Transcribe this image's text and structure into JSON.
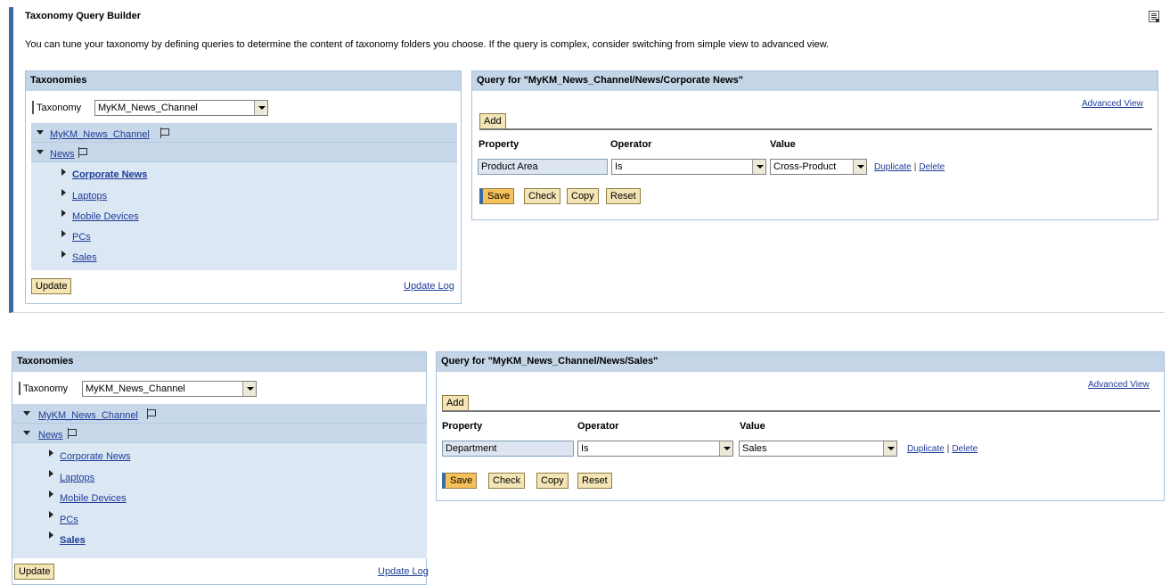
{
  "page": {
    "title": "Taxonomy Query Builder",
    "intro": "You can tune your taxonomy by defining queries to determine the content of taxonomy folders you choose. If the query is complex, consider switching from simple view to advanced view."
  },
  "section1": {
    "taxonomies": {
      "header": "Taxonomies",
      "taxonomy_label": "Taxonomy",
      "taxonomy_value": "MyKM_News_Channel",
      "tree": {
        "root": "MyKM_News_Channel",
        "child": "News",
        "items": [
          "Corporate News",
          "Laptops",
          "Mobile Devices",
          "PCs",
          "Sales"
        ],
        "selected": "Corporate News"
      },
      "update_button": "Update",
      "update_log": "Update Log"
    },
    "query": {
      "header": "Query for \"MyKM_News_Channel/News/Corporate News\"",
      "advanced_view": "Advanced View",
      "add_button": "Add",
      "col_property": "Property",
      "col_operator": "Operator",
      "col_value": "Value",
      "row": {
        "property": "Product Area",
        "operator": "Is",
        "value": "Cross-Product"
      },
      "duplicate": "Duplicate",
      "delete": "Delete",
      "buttons": {
        "save": "Save",
        "check": "Check",
        "copy": "Copy",
        "reset": "Reset"
      }
    }
  },
  "section2": {
    "taxonomies": {
      "header": "Taxonomies",
      "taxonomy_label": "Taxonomy",
      "taxonomy_value": "MyKM_News_Channel",
      "tree": {
        "root": "MyKM_News_Channel",
        "child": "News",
        "items": [
          "Corporate News",
          "Laptops",
          "Mobile Devices",
          "PCs",
          "Sales"
        ],
        "selected": "Sales"
      },
      "update_button": "Update",
      "update_log": "Update Log"
    },
    "query": {
      "header": "Query for \"MyKM_News_Channel/News/Sales\"",
      "advanced_view": "Advanced View",
      "add_button": "Add",
      "col_property": "Property",
      "col_operator": "Operator",
      "col_value": "Value",
      "row": {
        "property": "Department",
        "operator": "Is",
        "value": "Sales"
      },
      "duplicate": "Duplicate",
      "delete": "Delete",
      "buttons": {
        "save": "Save",
        "check": "Check",
        "copy": "Copy",
        "reset": "Reset"
      }
    }
  },
  "colors": {
    "accent_bar": "#3a6aa8",
    "panel_header": "#c3d5e7",
    "tree_background": "#dbe7f3",
    "button": "#f3e5b6",
    "save_button": "#f7c15a",
    "link": "#1f3c99"
  },
  "icons": {
    "doc": "document-list-icon",
    "flag": "flag-icon",
    "expanded": "triangle-down-icon",
    "collapsed": "triangle-right-icon",
    "dropdown": "dropdown-arrow-icon"
  }
}
